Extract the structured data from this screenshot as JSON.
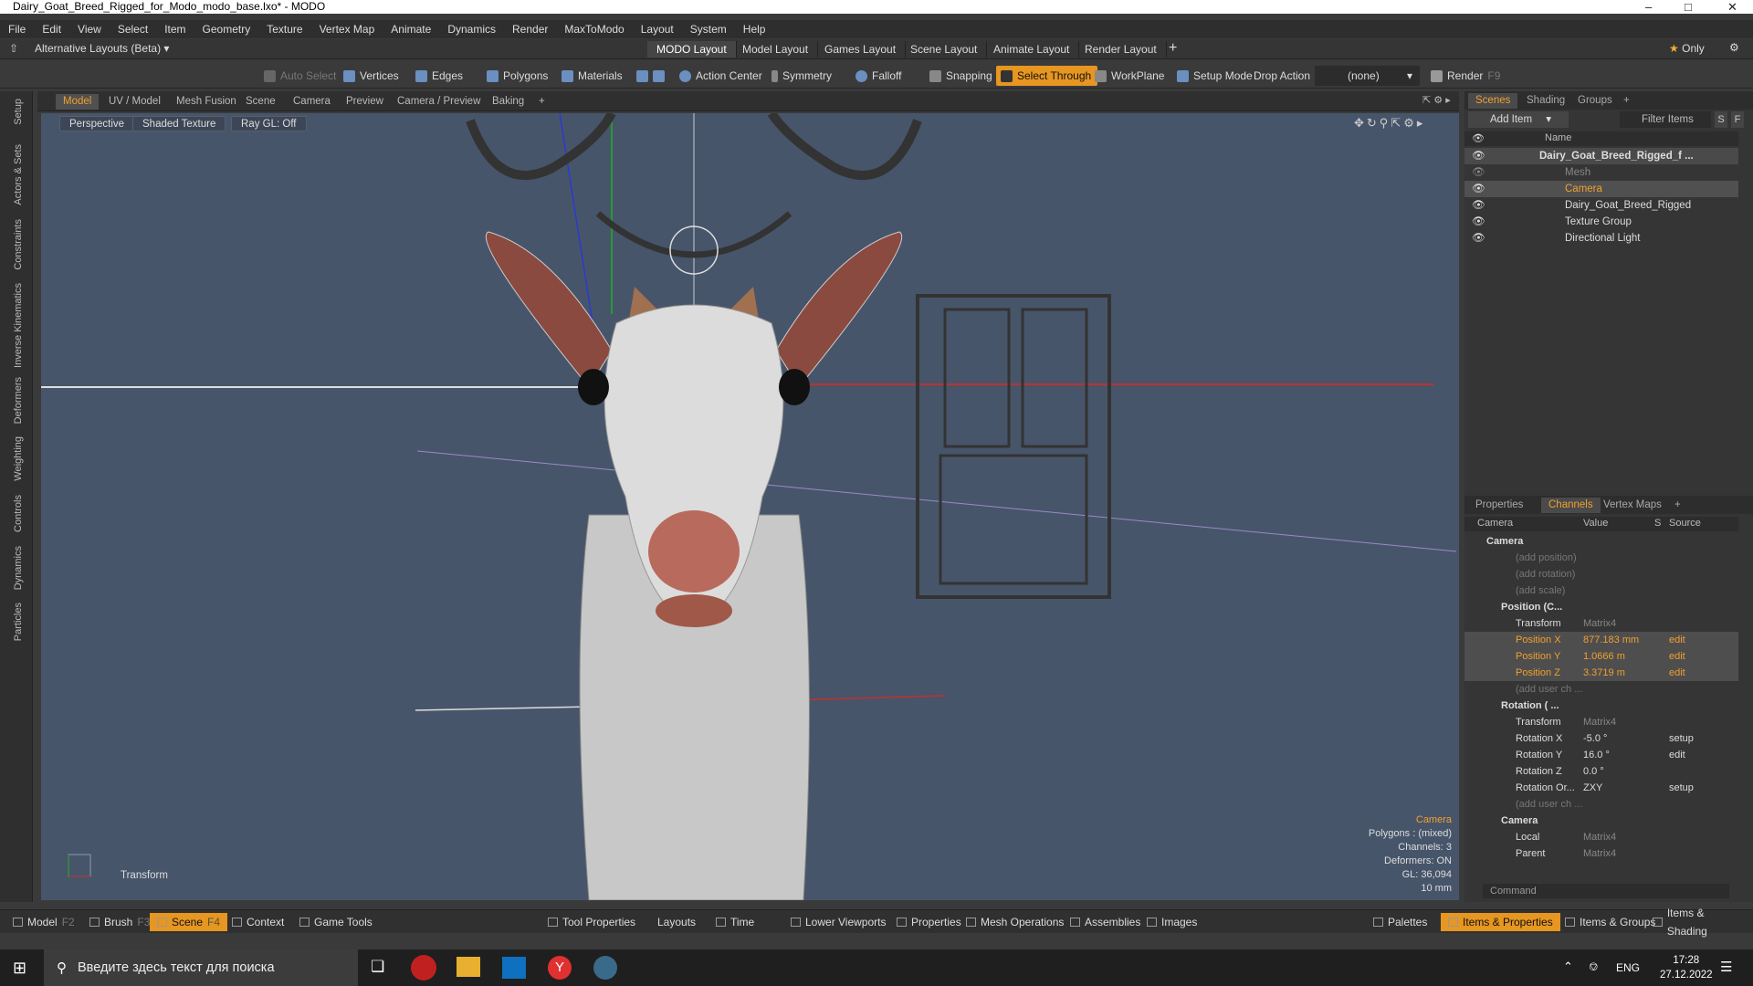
{
  "window": {
    "title": "Dairy_Goat_Breed_Rigged_for_Modo_modo_base.lxo* - MODO"
  },
  "menu": [
    "File",
    "Edit",
    "View",
    "Select",
    "Item",
    "Geometry",
    "Texture",
    "Vertex Map",
    "Animate",
    "Dynamics",
    "Render",
    "MaxToModo",
    "Layout",
    "System",
    "Help"
  ],
  "layoutbar": {
    "alt": "Alternative Layouts (Beta)",
    "tabs": [
      "MODO Layout",
      "Model Layout",
      "Games Layout",
      "Scene Layout",
      "Animate Layout",
      "Render Layout"
    ],
    "only": "Only"
  },
  "toolbar": {
    "auto_select": "Auto Select",
    "vertices": "Vertices",
    "edges": "Edges",
    "polygons": "Polygons",
    "materials": "Materials",
    "action_center": "Action Center",
    "symmetry": "Symmetry",
    "falloff": "Falloff",
    "snapping": "Snapping",
    "select_through": "Select Through",
    "workplane": "WorkPlane",
    "setup_mode": "Setup Mode",
    "drop_action": "Drop Action",
    "none": "(none)",
    "render": "Render",
    "render_key": "F9"
  },
  "left_tabs": [
    "Setup",
    "Actors & Sets",
    "Constraints",
    "Inverse Kinematics",
    "Deformers",
    "Weighting",
    "Controls",
    "Dynamics",
    "Particles"
  ],
  "viewport_tabs": [
    "Model",
    "UV / Model",
    "Mesh Fusion",
    "Scene",
    "Camera",
    "Preview",
    "Camera / Preview",
    "Baking"
  ],
  "viewport": {
    "perspective": "Perspective",
    "shading": "Shaded Texture",
    "raygl": "Ray GL: Off",
    "transform_label": "Transform",
    "info": [
      "Camera",
      "Polygons : (mixed)",
      "Channels: 3",
      "Deformers: ON",
      "GL: 36,094",
      "10 mm"
    ]
  },
  "scenes": {
    "tabs": [
      "Scenes",
      "Shading",
      "Groups"
    ],
    "add_item": "Add Item",
    "filter": "Filter Items",
    "s": "S",
    "f": "F",
    "name_header": "Name",
    "items": [
      {
        "label": "Dairy_Goat_Breed_Rigged_f ..."
      },
      {
        "label": "Mesh"
      },
      {
        "label": "Camera"
      },
      {
        "label": "Dairy_Goat_Breed_Rigged"
      },
      {
        "label": "Texture Group"
      },
      {
        "label": "Directional Light"
      }
    ]
  },
  "channels": {
    "tabs": [
      "Properties",
      "Channels",
      "Vertex Maps"
    ],
    "headers": [
      "Camera",
      "Value",
      "S",
      "Source"
    ],
    "rows": [
      {
        "name": "Camera",
        "value": "",
        "src": ""
      },
      {
        "name": "(add position)",
        "value": "",
        "src": ""
      },
      {
        "name": "(add rotation)",
        "value": "",
        "src": ""
      },
      {
        "name": "(add scale)",
        "value": "",
        "src": ""
      },
      {
        "name": "Position (C...",
        "value": "",
        "src": ""
      },
      {
        "name": "Transform",
        "value": "Matrix4",
        "src": ""
      },
      {
        "name": "Position X",
        "value": "877.183 mm",
        "src": "edit"
      },
      {
        "name": "Position Y",
        "value": "1.0666 m",
        "src": "edit"
      },
      {
        "name": "Position Z",
        "value": "3.3719 m",
        "src": "edit"
      },
      {
        "name": "(add user ch ...",
        "value": "",
        "src": ""
      },
      {
        "name": "Rotation ( ...",
        "value": "",
        "src": ""
      },
      {
        "name": "Transform",
        "value": "Matrix4",
        "src": ""
      },
      {
        "name": "Rotation X",
        "value": "-5.0 °",
        "src": "setup"
      },
      {
        "name": "Rotation Y",
        "value": "16.0 °",
        "src": "edit"
      },
      {
        "name": "Rotation Z",
        "value": "0.0 °",
        "src": ""
      },
      {
        "name": "Rotation Or...",
        "value": "ZXY",
        "src": "setup"
      },
      {
        "name": "(add user ch ...",
        "value": "",
        "src": ""
      },
      {
        "name": "Camera",
        "value": "",
        "src": ""
      },
      {
        "name": "Local",
        "value": "Matrix4",
        "src": ""
      },
      {
        "name": "Parent",
        "value": "Matrix4",
        "src": ""
      }
    ],
    "command_placeholder": "Command"
  },
  "bottombar": {
    "items": [
      "Model",
      "Brush",
      "Scene",
      "Context",
      "Game Tools",
      "Tool Properties",
      "Layouts",
      "Time",
      "Lower Viewports",
      "Properties",
      "Mesh Operations",
      "Assemblies",
      "Images",
      "Palettes",
      "Items & Properties",
      "Items & Groups",
      "Items & Shading"
    ],
    "keys": [
      "F2",
      "F3",
      "F4"
    ]
  },
  "taskbar": {
    "search": "Введите здесь текст для поиска",
    "lang": "ENG",
    "time": "17:28",
    "date": "27.12.2022"
  }
}
